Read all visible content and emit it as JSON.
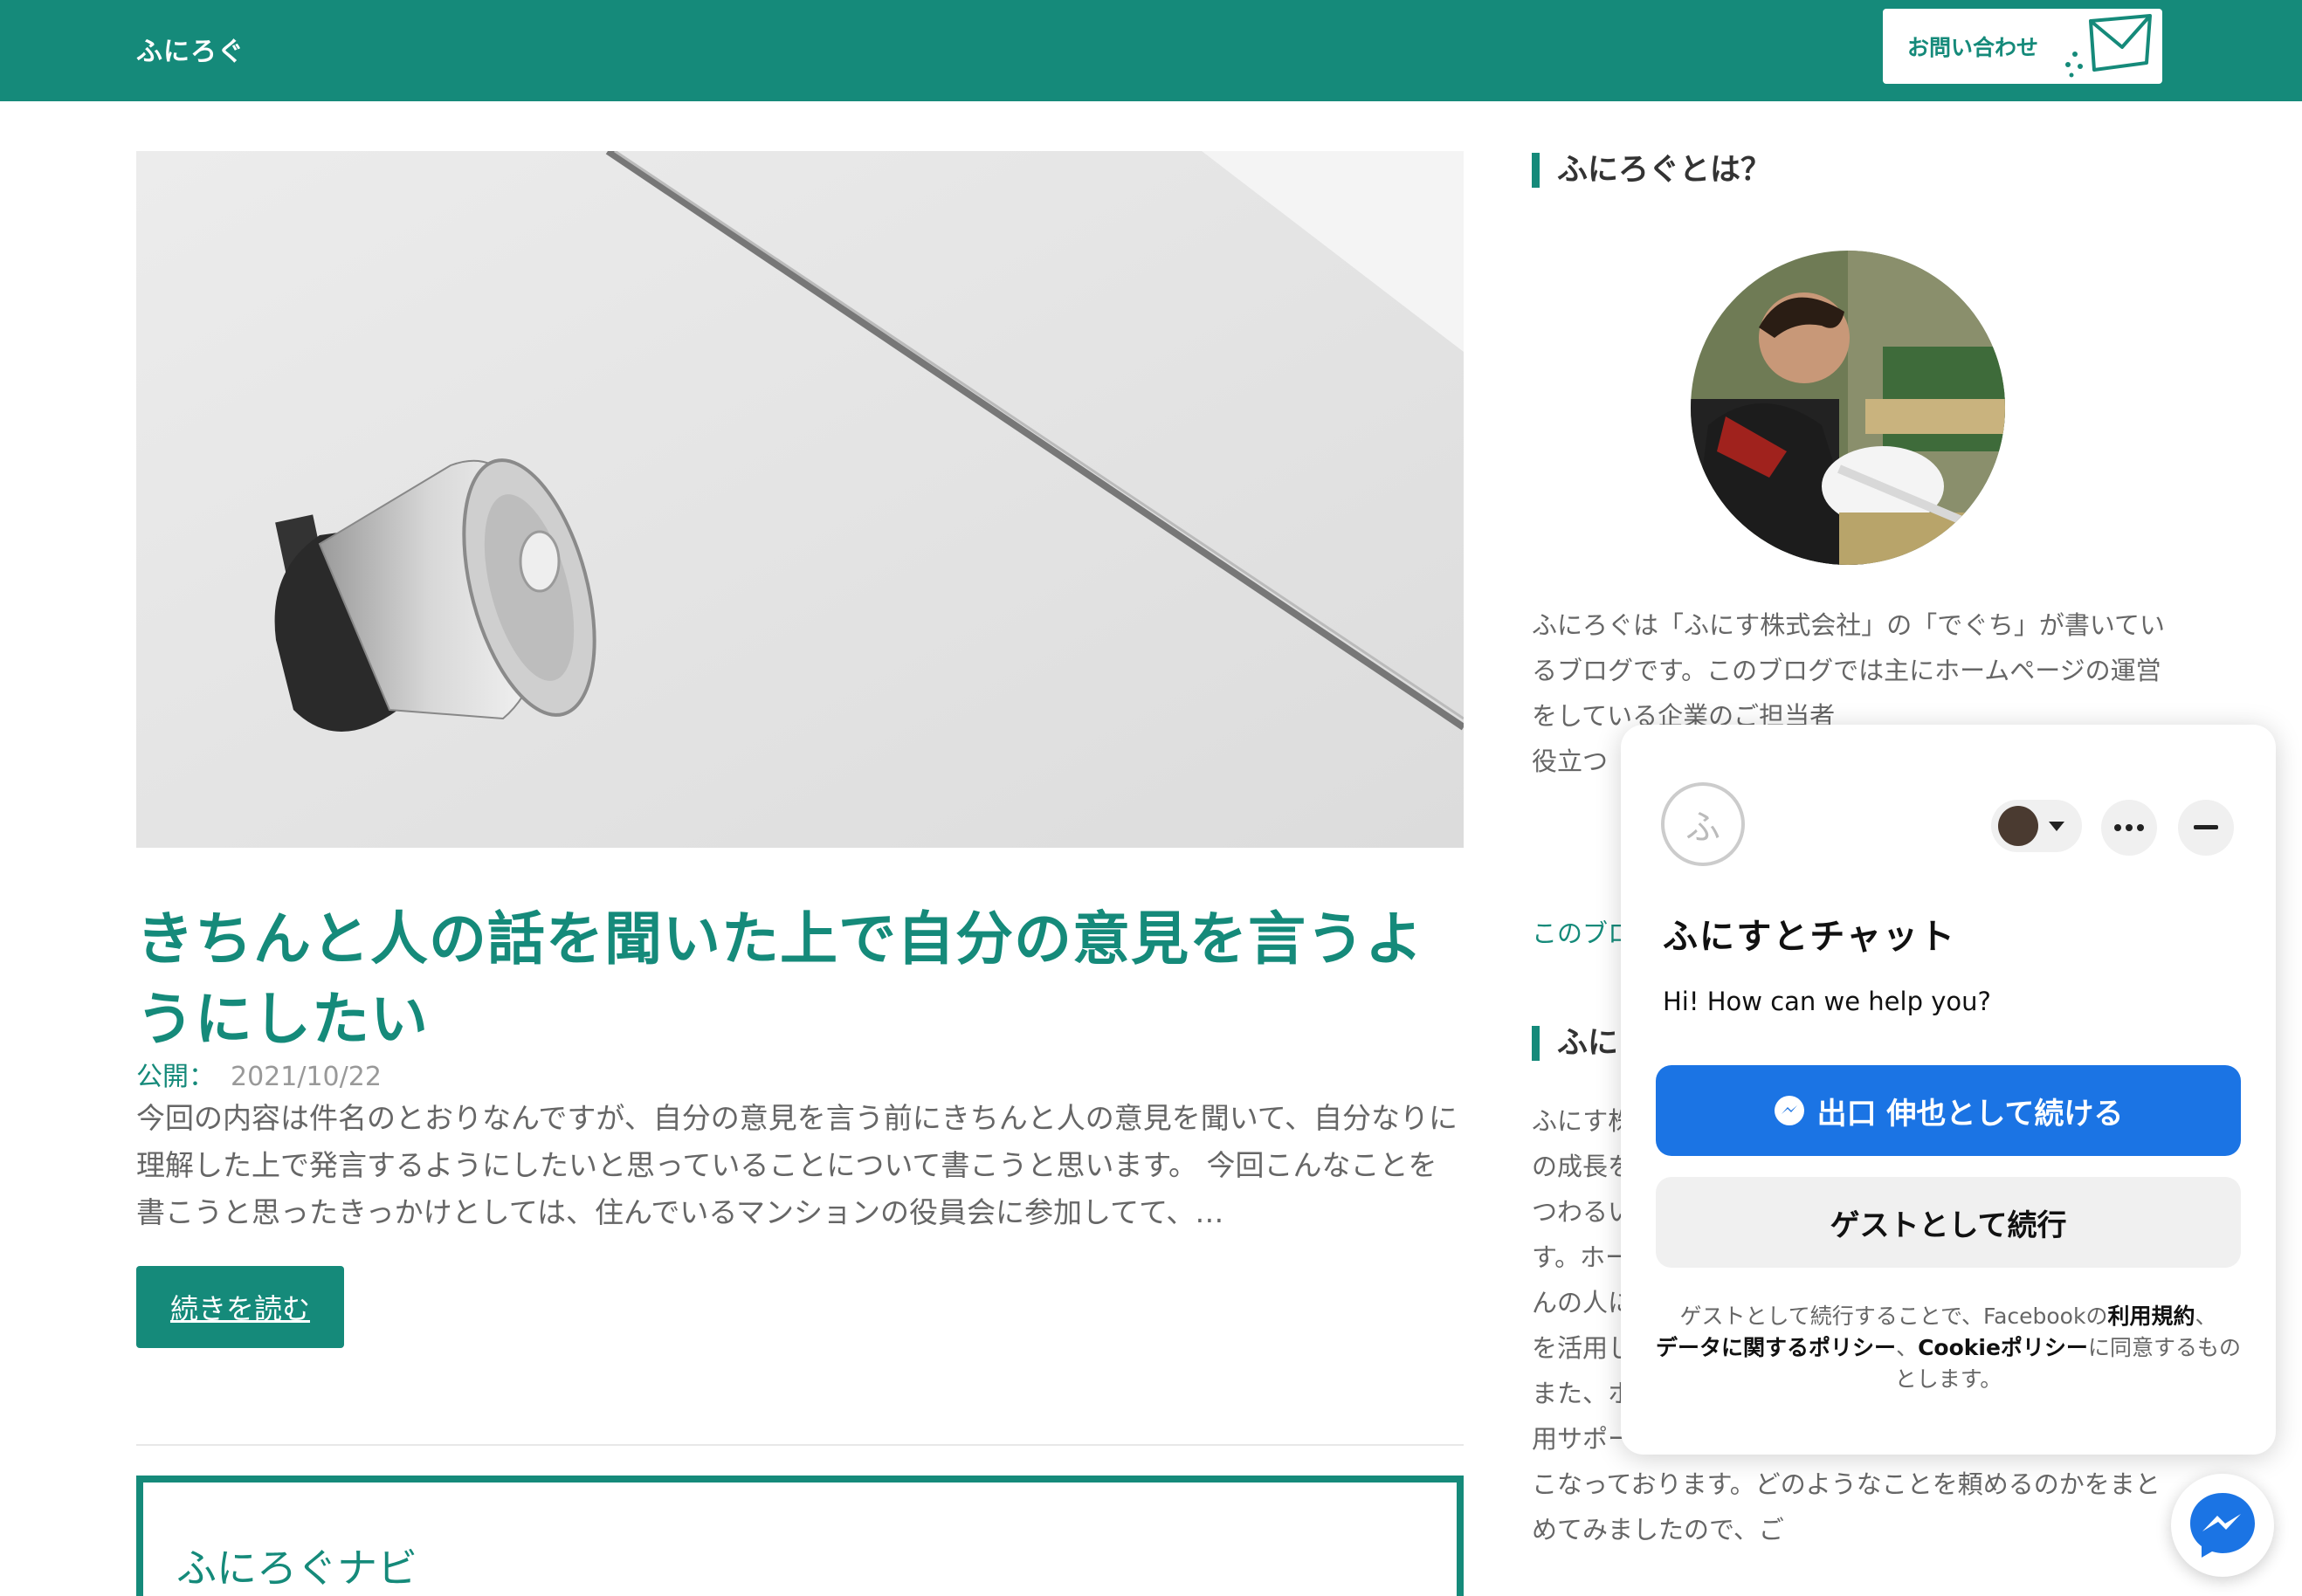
{
  "theme": {
    "accent": "#158a7a",
    "messenger_blue": "#1b74e4"
  },
  "header": {
    "site_title": "ふにろぐ",
    "contact_label": "お問い合わせ",
    "mail_icon": "envelope-icon"
  },
  "post": {
    "hero_image_desc": "megaphone-photo",
    "title": "きちんと人の話を聞いた上で自分の意見を言うようにしたい",
    "published_label": "公開：",
    "published_date": "2021/10/22",
    "excerpt": "今回の内容は件名のとおりなんですが、自分の意見を言う前にきちんと人の意見を聞いて、自分なりに理解した上で発言するようにしたいと思っていることについて書こうと思います。 今回こんなことを書こうと思ったきっかけとしては、住んでいるマンションの役員会に参加してて、…",
    "read_more": "続きを読む"
  },
  "navi": {
    "title": "ふにろぐナビ"
  },
  "sidebar": {
    "about_heading": "ふにろぐとは？",
    "about_text": "ふにろぐは「ふにす株式会社」の「でぐち」が書いているブログです。このブログでは主にホームページの運営をしている企業のご担当者　　　　　　　　　　　　　役立つ　　　　　　　　　　　　　　と」を中",
    "about_link": "このブロ",
    "company_heading": "ふにす",
    "company_text": "ふにす株　　　　　　　　　　　　　　　　　　　　　　　　　の成長を　　　　　　　　　　　　　　　　　　　　　　　　　つわるい　　　　　　　　　　　　　　　　　　　　　　　　　す。ホームペ　　　　　　　　　　　　　　　　　　　　　　　　んの人に　　　　　　　　　　　　　　　　　　　　　　　　　を活用し　　　　　　　　　　　　　　　　　　　　　　　　　また、ホ　　　　　　　　　　　　　　　　　　　　　　　　　用サポートなど、幅広くWebにまつわる諸々のことをおこなっております。どのようなことを頼めるのかをまとめてみましたので、ご"
  },
  "chat": {
    "logo_glyph": "ふ",
    "name": "ふにすとチャット",
    "greeting": "Hi! How can we help you?",
    "primary_btn": "出口 伸也として続ける",
    "secondary_btn": "ゲストとして続行",
    "legal_pre": "ゲストとして続行することで、Facebookの",
    "legal_terms": "利用規約",
    "legal_sep1": "、",
    "legal_data": "データに関するポリシー",
    "legal_sep2": "、",
    "legal_cookie": "Cookieポリシー",
    "legal_post": "に同意するものとします。"
  }
}
